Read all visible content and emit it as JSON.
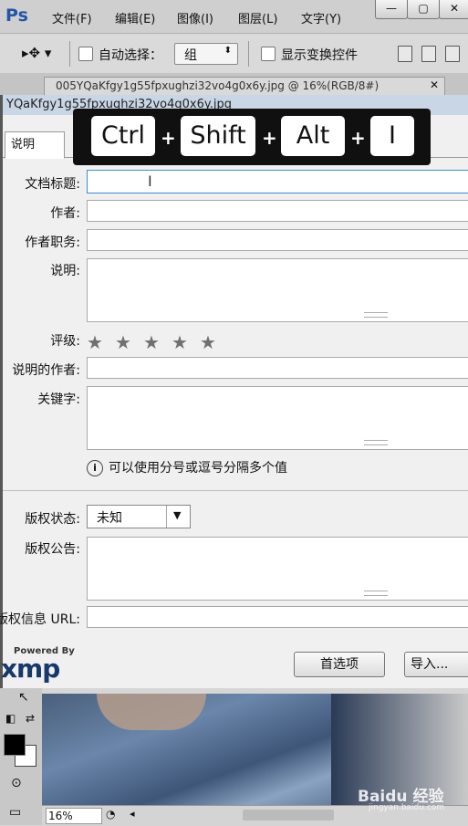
{
  "app": {
    "logo": "Ps"
  },
  "menu": [
    "文件(F)",
    "编辑(E)",
    "图像(I)",
    "图层(L)",
    "文字(Y)"
  ],
  "options_bar": {
    "auto_select_label": "自动选择：",
    "auto_select_value": "组",
    "show_transform_label": "显示变换控件"
  },
  "document_tab": {
    "label": "005YQaKfgy1g55fpxughzi32vo4g0x6y.jpg @ 16%(RGB/8#)"
  },
  "dialog": {
    "title": "YQaKfgy1g55fpxughzi32vo4g0x6y.jpg",
    "active_tab": "说明",
    "fields": {
      "doc_title_label": "文档标题:",
      "author_label": "作者:",
      "author_title_label": "作者职务:",
      "description_label": "说明:",
      "rating_label": "评级:",
      "desc_writer_label": "说明的作者:",
      "keywords_label": "关键字:",
      "keywords_hint": "可以使用分号或逗号分隔多个值",
      "copyright_status_label": "版权状态:",
      "copyright_status_value": "未知",
      "copyright_notice_label": "版权公告:",
      "copyright_url_label": "版权信息 URL:"
    },
    "rating": {
      "value": 0,
      "max": 5
    },
    "xmp": {
      "powered_by": "Powered By",
      "logo": "xmp"
    },
    "buttons": {
      "prefs": "首选项",
      "import": "导入..."
    }
  },
  "shortcut_overlay": {
    "keys": [
      "Ctrl",
      "Shift",
      "Alt",
      "I"
    ],
    "separator": "+"
  },
  "statusbar": {
    "zoom": "16%"
  },
  "watermark": {
    "brand": "Baidu 经验",
    "url": "jingyan.baidu.com"
  }
}
